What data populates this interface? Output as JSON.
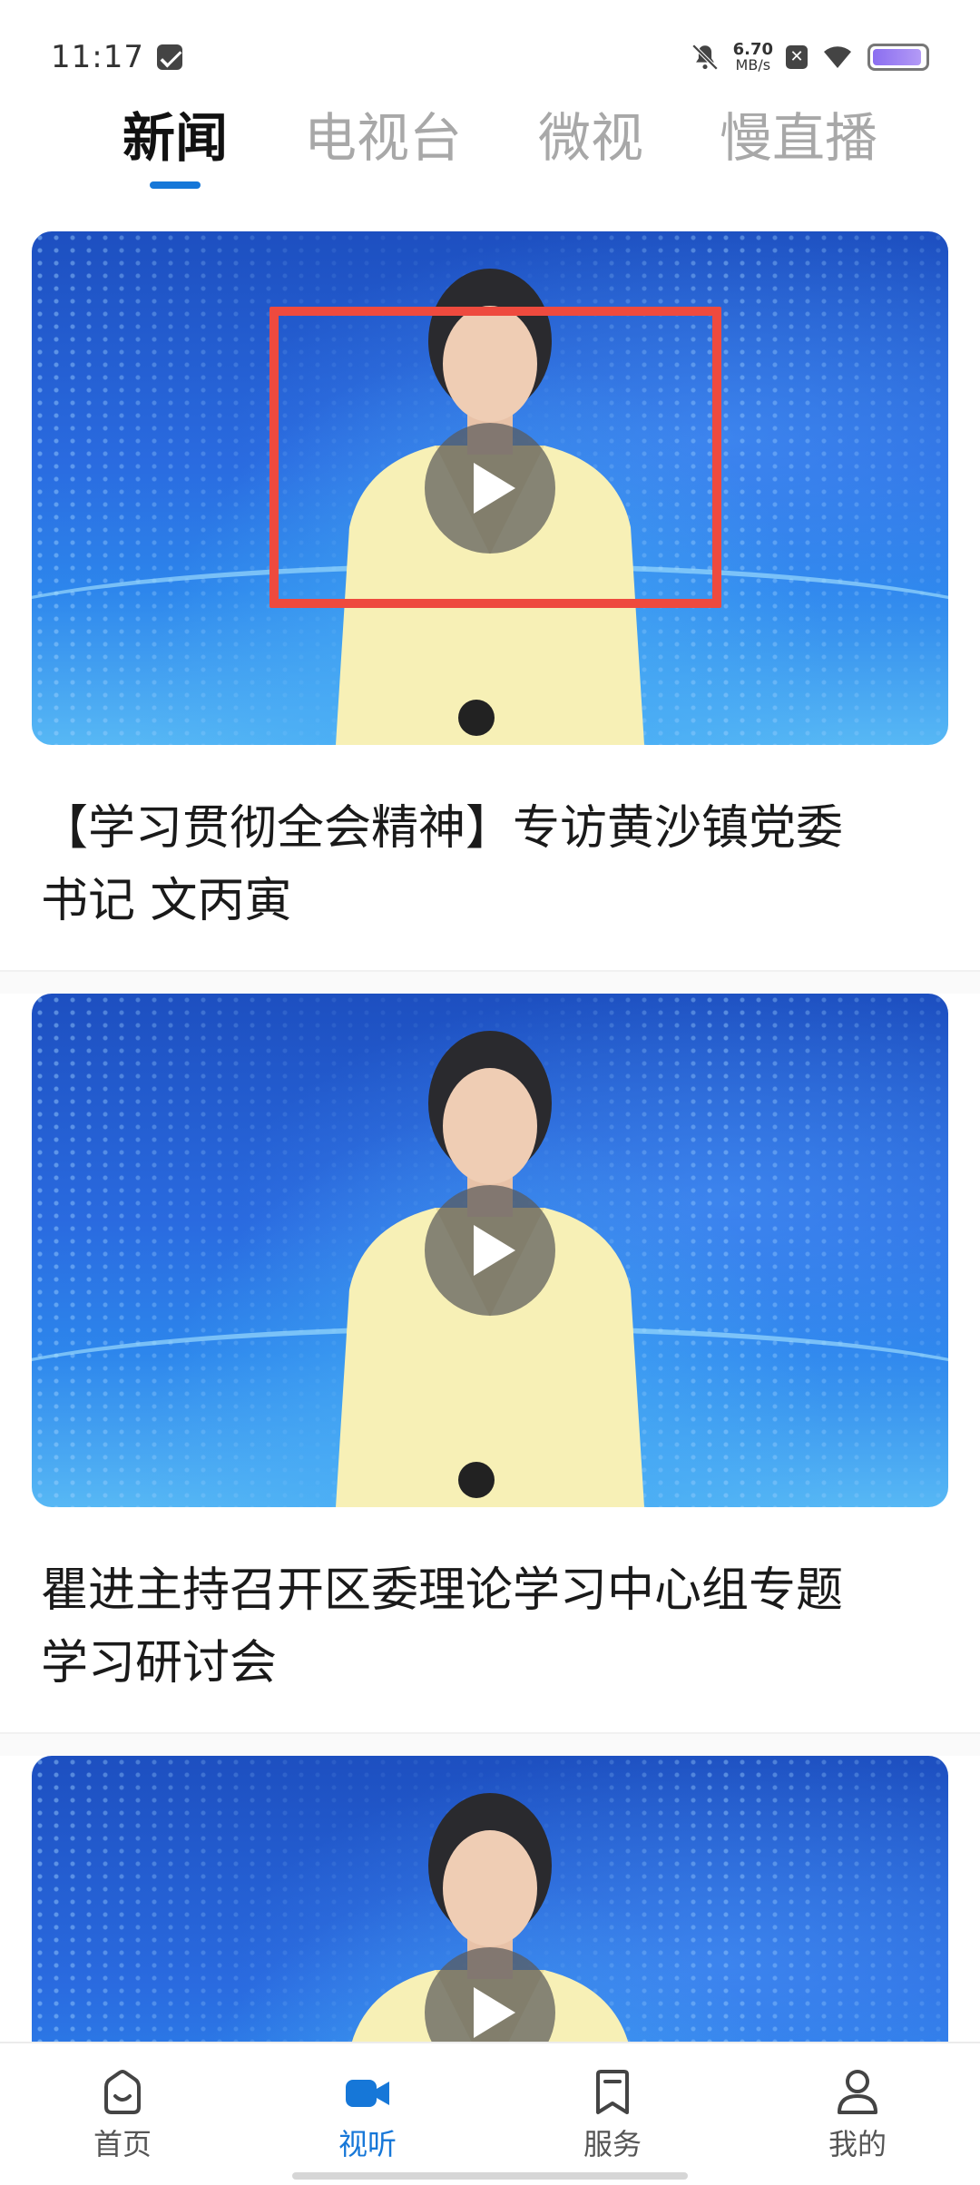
{
  "status_bar": {
    "time": "11:17",
    "net_speed_value": "6.70",
    "net_speed_unit": "MB/s",
    "x_badge": "✕",
    "battery_level": 0.95,
    "battery_color": "#8b6ef0"
  },
  "top_tabs": [
    {
      "label": "新闻",
      "active": true
    },
    {
      "label": "电视台",
      "active": false
    },
    {
      "label": "微视",
      "active": false
    },
    {
      "label": "慢直播",
      "active": false
    }
  ],
  "accent_color": "#1677d8",
  "highlight_color": "#ee4a3e",
  "feed": [
    {
      "title_line1": "【学习贯彻全会精神】专访黄沙镇党委",
      "title_line2": "书记 文丙寅",
      "icon": "play-icon"
    },
    {
      "title_line1": "瞿进主持召开区委理论学习中心组专题",
      "title_line2": "学习研讨会",
      "icon": "play-icon"
    },
    {
      "title_line1": "",
      "title_line2": "",
      "icon": "play-icon"
    }
  ],
  "bottom_nav": [
    {
      "label": "首页",
      "icon": "home-icon",
      "active": false
    },
    {
      "label": "视听",
      "icon": "video-camera-icon",
      "active": true
    },
    {
      "label": "服务",
      "icon": "bookmark-icon",
      "active": false
    },
    {
      "label": "我的",
      "icon": "person-icon",
      "active": false
    }
  ]
}
